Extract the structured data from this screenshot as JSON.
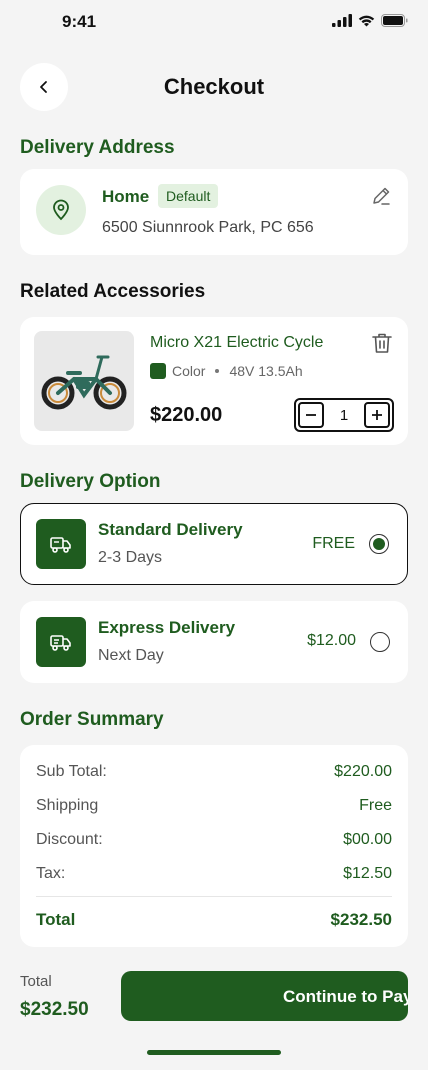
{
  "status": {
    "time": "9:41"
  },
  "header": {
    "title": "Checkout"
  },
  "address": {
    "section_title": "Delivery Address",
    "name": "Home",
    "badge": "Default",
    "line": "6500 Siunnrook Park, PC 656"
  },
  "accessories": {
    "section_title": "Related Accessories",
    "product": {
      "name": "Micro X21 Electric Cycle",
      "color_label": "Color",
      "spec": "48V 13.5Ah",
      "price": "$220.00",
      "quantity": "1"
    }
  },
  "delivery": {
    "section_title": "Delivery Option",
    "options": [
      {
        "name": "Standard Delivery",
        "eta": "2-3 Days",
        "price": "FREE",
        "selected": true
      },
      {
        "name": "Express Delivery",
        "eta": "Next Day",
        "price": "$12.00",
        "selected": false
      }
    ]
  },
  "summary": {
    "section_title": "Order Summary",
    "rows": [
      {
        "label": "Sub Total:",
        "value": "$220.00"
      },
      {
        "label": "Shipping",
        "value": "Free"
      },
      {
        "label": "Discount:",
        "value": "$00.00"
      },
      {
        "label": "Tax:",
        "value": "$12.50"
      }
    ],
    "total_label": "Total",
    "total_value": "$232.50"
  },
  "footer": {
    "total_label": "Total",
    "total_value": "$232.50",
    "button_label": "Continue to Payment"
  },
  "colors": {
    "accent": "#1f5c1f",
    "accent_light": "#e3f1e0",
    "background": "#f4f4f4"
  }
}
